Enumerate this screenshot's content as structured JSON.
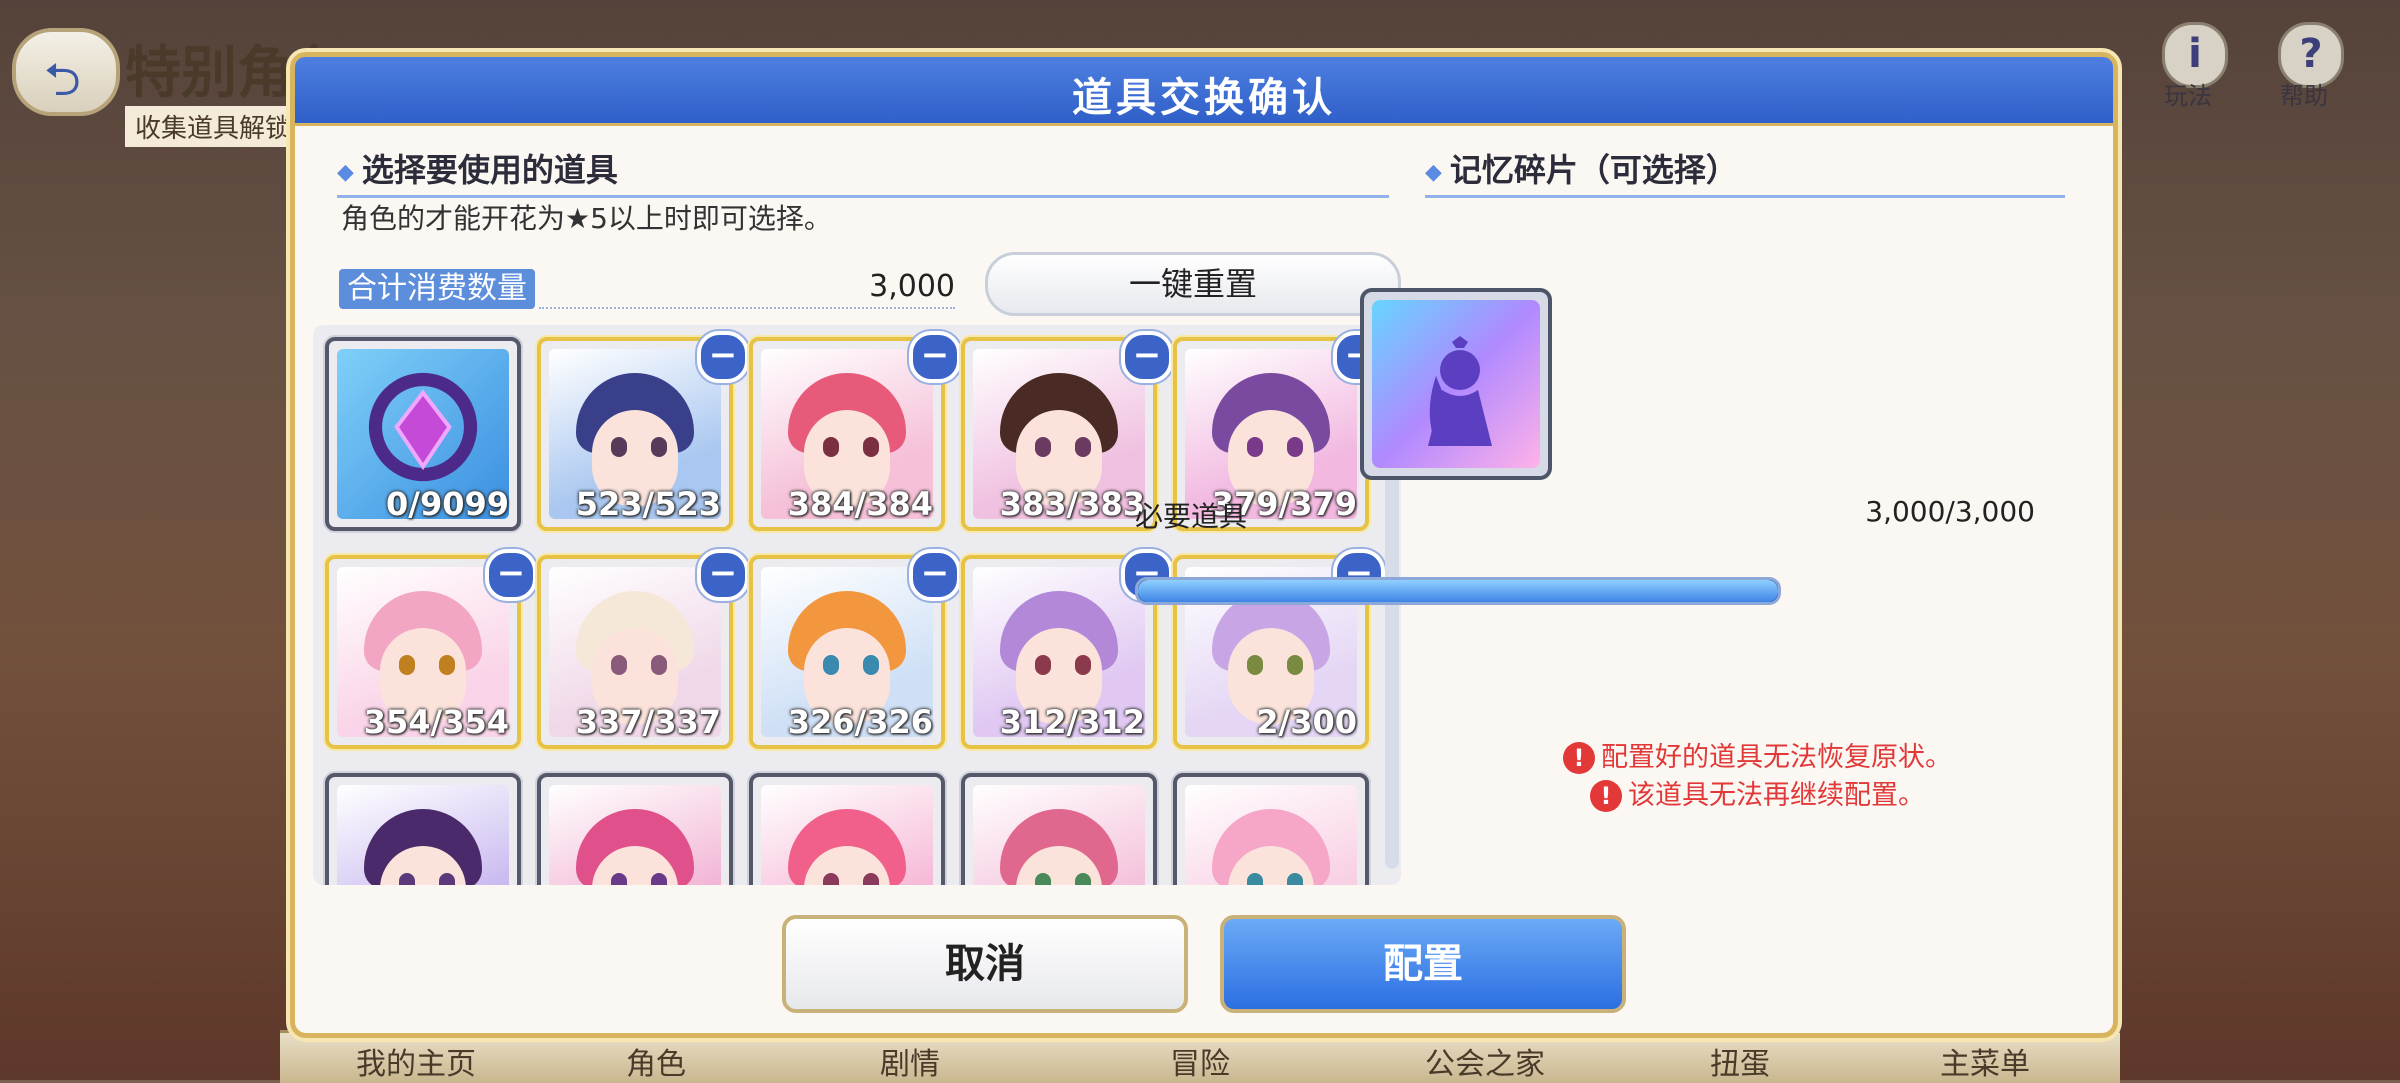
{
  "background": {
    "screen_title": "特别角色",
    "screen_subtitle": "收集道具解锁",
    "top_icons": [
      {
        "name": "play-info",
        "glyph": "i",
        "label": "玩法"
      },
      {
        "name": "help",
        "glyph": "?",
        "label": "帮助"
      }
    ],
    "nav_items": [
      "我的主页",
      "角色",
      "剧情",
      "冒险",
      "公会之家",
      "扭蛋",
      "主菜单"
    ]
  },
  "dialog": {
    "title": "道具交换确认",
    "left_section": {
      "heading": "选择要使用的道具",
      "note": "角色的才能开花为★5以上时即可选择。",
      "total_label": "合计消费数量",
      "total_value": "3,000",
      "reset_label": "一键重置"
    },
    "items": [
      {
        "count": "0/9099",
        "type": "gem",
        "frame": "silver",
        "removable": false
      },
      {
        "count": "523/523",
        "frame": "gold",
        "removable": true,
        "hair": "#3a3f8a",
        "eye": "#5a3a5a",
        "bg": "#a9c7f0"
      },
      {
        "count": "384/384",
        "frame": "gold",
        "removable": true,
        "hair": "#e85a7a",
        "eye": "#7a3040",
        "bg": "#f5c0d8"
      },
      {
        "count": "383/383",
        "frame": "gold",
        "removable": true,
        "hair": "#4a2a24",
        "eye": "#6a3a60",
        "bg": "#f0c0e0"
      },
      {
        "count": "379/379",
        "frame": "gold",
        "removable": true,
        "hair": "#7a4aa0",
        "eye": "#7a3a8a",
        "bg": "#f2b8e0"
      },
      {
        "count": "354/354",
        "frame": "gold",
        "removable": true,
        "hair": "#f2a6c4",
        "eye": "#c08020",
        "bg": "#fad4e8"
      },
      {
        "count": "337/337",
        "frame": "gold",
        "removable": true,
        "hair": "#f6e8d8",
        "eye": "#8a5a7a",
        "bg": "#f0d8e8"
      },
      {
        "count": "326/326",
        "frame": "gold",
        "removable": true,
        "hair": "#f3973f",
        "eye": "#3a8ab0",
        "bg": "#cfe0f6"
      },
      {
        "count": "312/312",
        "frame": "gold",
        "removable": true,
        "hair": "#b388d8",
        "eye": "#8a3a4a",
        "bg": "#e0c8f2"
      },
      {
        "count": "2/300",
        "frame": "gold",
        "removable": true,
        "hair": "#c8a6e6",
        "eye": "#7a8a40",
        "bg": "#e4d6f4"
      },
      {
        "count": "",
        "frame": "silver",
        "removable": false,
        "hair": "#4a2a6a",
        "eye": "#5a3a7a",
        "bg": "#c8b8f0"
      },
      {
        "count": "",
        "frame": "silver",
        "removable": false,
        "hair": "#e0508a",
        "eye": "#6a3a8a",
        "bg": "#f2b4d4"
      },
      {
        "count": "",
        "frame": "silver",
        "removable": false,
        "hair": "#f0608a",
        "eye": "#8a3a5a",
        "bg": "#f6b8d6"
      },
      {
        "count": "",
        "frame": "silver",
        "removable": false,
        "hair": "#e0688e",
        "eye": "#4a8a5a",
        "bg": "#f4c0da"
      },
      {
        "count": "",
        "frame": "silver",
        "removable": false,
        "hair": "#f6a6c6",
        "eye": "#3a8aa0",
        "bg": "#f8cde2"
      }
    ],
    "right_section": {
      "heading": "记忆碎片（可选择）",
      "required_label": "必要道具",
      "required_value": "3,000/3,000",
      "required_progress": 1.0,
      "warnings": [
        "配置好的道具无法恢复原状。",
        "该道具无法再继续配置。"
      ]
    },
    "buttons": {
      "cancel": "取消",
      "confirm": "配置"
    }
  }
}
